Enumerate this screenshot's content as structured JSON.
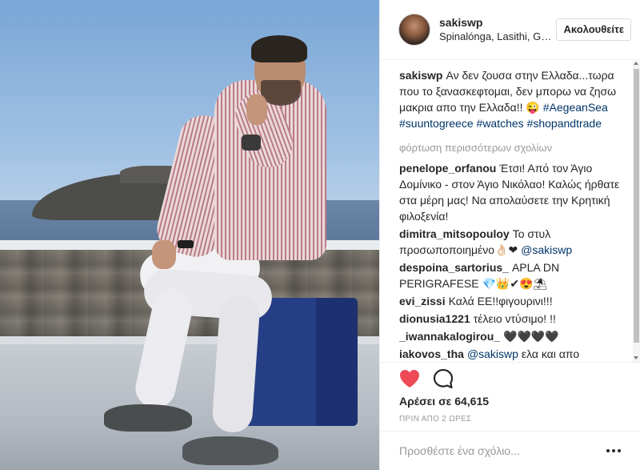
{
  "post": {
    "user": {
      "username": "sakiswp",
      "location": "Spinalónga, Lasithi, Greece",
      "follow_label": "Ακολουθείτε"
    },
    "caption": {
      "author": "sakiswp",
      "text": "Αν δεν ζουσα στην Ελλαδα...τωρα που το ξανασκεφτομαι, δεν μπορω να ζησω μακρια απο την Ελλαδα!! 😜",
      "hashtags": [
        "#AegeanSea",
        "#suuntogreece",
        "#watches",
        "#shopandtrade"
      ]
    },
    "load_more_label": "φόρτωση περισσότερων σχολίων",
    "comments": [
      {
        "author": "penelope_orfanou",
        "text": "Έτσι! Από τον Άγιο Δομίνικο - στον Άγιο Νικόλαο! Καλώς ήρθατε στα μέρη μας! Να απολαύσετε την Κρητική φιλοξενία!"
      },
      {
        "author": "dimitra_mitsopouloy",
        "text": "Το στυλ προσωποποιημένο👌🏻❤",
        "mention": "@sakiswp"
      },
      {
        "author": "despoina_sartorius_",
        "text": "APLA DN PERIGRAFESE 💎👑✔😍⛱"
      },
      {
        "author": "evi_zissi",
        "text": "Καλά ΕΕ!!φιγουρινι!!!"
      },
      {
        "author": "dionusia1221",
        "text": "τέλειο ντύσιμο! !!"
      },
      {
        "author": "_iwannakalogirou_",
        "text": "🖤🖤🖤🖤"
      },
      {
        "author": "iakovos_tha",
        "mention": "@sakiswp",
        "text": "ελα και απο"
      }
    ],
    "likes_label": "Αρέσει σε 64,615",
    "time_label": "ΠΡΙΝ ΑΠΟ 2 ΩΡΕΣ",
    "add_comment_placeholder": "Προσθέστε ένα σχόλιο...",
    "icons": {
      "like": "heart-icon",
      "comment": "comment-icon",
      "more": "more-options-icon"
    },
    "colors": {
      "like_red": "#ed4956",
      "link_blue": "#003569",
      "muted_gray": "#999999"
    }
  }
}
